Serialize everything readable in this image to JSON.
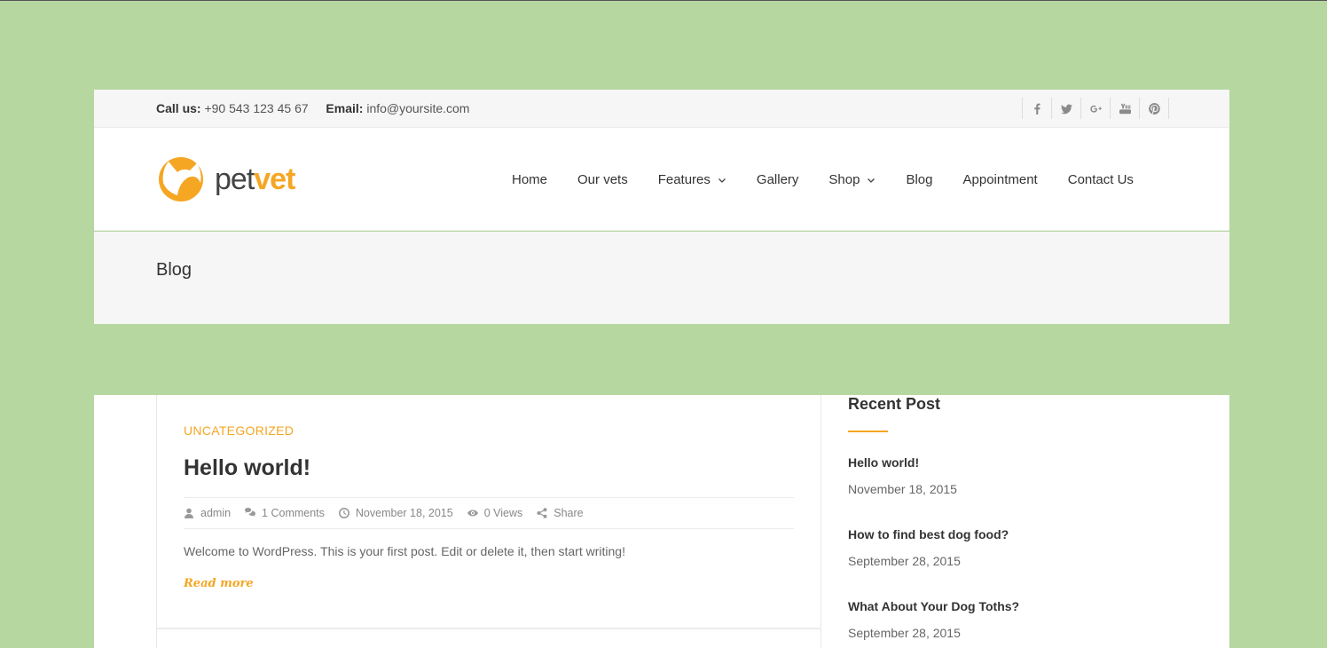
{
  "topbar": {
    "call_label": "Call us:",
    "call_value": "+90 543 123 45 67",
    "email_label": "Email:",
    "email_value": "info@yoursite.com",
    "social": [
      "facebook-icon",
      "twitter-icon",
      "google-plus-icon",
      "youtube-icon",
      "pinterest-icon"
    ]
  },
  "logo": {
    "part1": "pet",
    "part2": "vet"
  },
  "nav": {
    "items": [
      {
        "label": "Home"
      },
      {
        "label": "Our vets"
      },
      {
        "label": "Features",
        "dropdown": true
      },
      {
        "label": "Gallery"
      },
      {
        "label": "Shop",
        "dropdown": true
      },
      {
        "label": "Blog"
      },
      {
        "label": "Appointment"
      },
      {
        "label": "Contact Us"
      }
    ]
  },
  "page_title": "Blog",
  "post": {
    "category": "UNCATEGORIZED",
    "title": "Hello world!",
    "meta": {
      "author": "admin",
      "comments": "1 Comments",
      "date": "November 18, 2015",
      "views": "0 Views",
      "share": "Share"
    },
    "excerpt": "Welcome to WordPress. This is your first post. Edit or delete it, then start writing!",
    "read_more": "Read more"
  },
  "sidebar": {
    "title": "Recent Post",
    "posts": [
      {
        "title": "Hello world!",
        "date": "November 18, 2015"
      },
      {
        "title": "How to find best dog food?",
        "date": "September 28, 2015"
      },
      {
        "title": "What About Your Dog Toths?",
        "date": "September 28, 2015"
      }
    ]
  },
  "colors": {
    "accent": "#f5a623",
    "background": "#b6d7a0"
  }
}
